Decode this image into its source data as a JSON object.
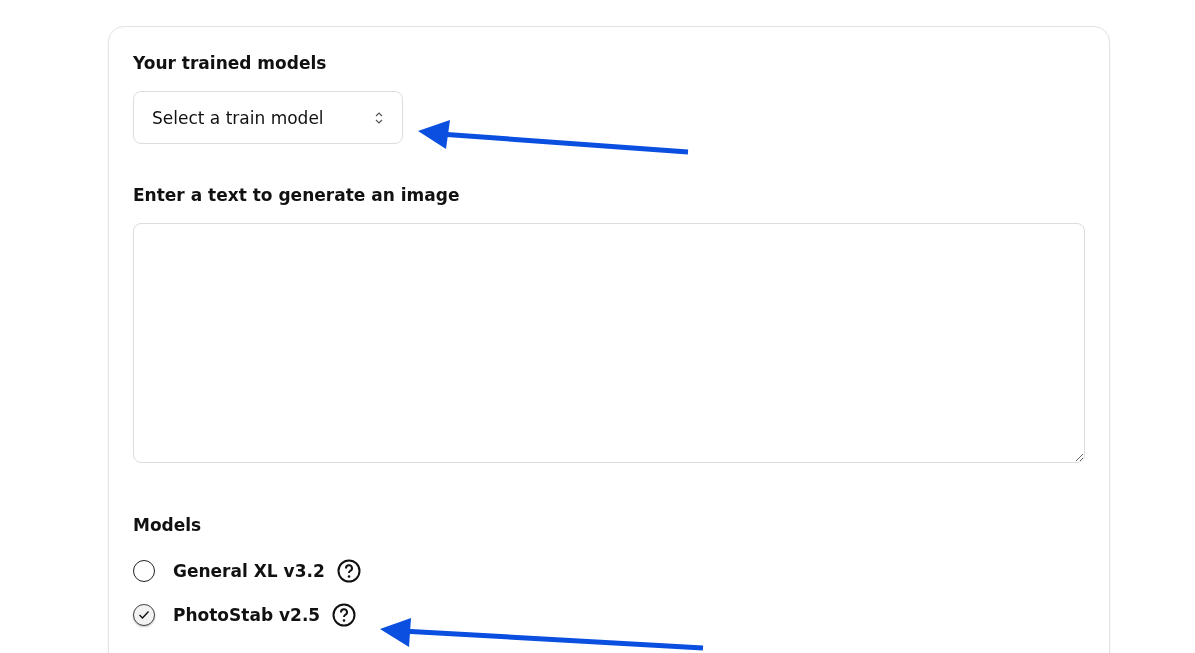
{
  "trained_models": {
    "label": "Your trained models",
    "select": {
      "placeholder": "Select a train model"
    }
  },
  "prompt": {
    "label": "Enter a text to generate an image"
  },
  "models": {
    "label": "Models",
    "options": [
      {
        "name": "General XL v3.2",
        "selected": false
      },
      {
        "name": "PhotoStab v2.5",
        "selected": true
      }
    ]
  }
}
